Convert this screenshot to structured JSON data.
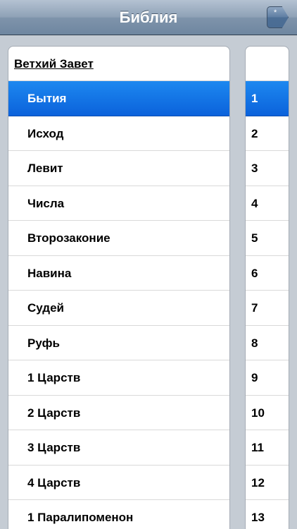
{
  "navbar": {
    "title": "Библия",
    "button_icon": "bookmark-tag-icon",
    "button_glyph": "*"
  },
  "books": {
    "section_title": "Ветхий Завет",
    "selected_index": 0,
    "items": [
      {
        "label": "Бытия"
      },
      {
        "label": "Исход"
      },
      {
        "label": "Левит"
      },
      {
        "label": "Числа"
      },
      {
        "label": "Второзаконие"
      },
      {
        "label": "Навина"
      },
      {
        "label": "Судей"
      },
      {
        "label": "Руфь"
      },
      {
        "label": "1 Царств"
      },
      {
        "label": "2 Царств"
      },
      {
        "label": "3 Царств"
      },
      {
        "label": "4 Царств"
      },
      {
        "label": "1 Паралипоменон"
      }
    ]
  },
  "chapters": {
    "selected_index": 0,
    "items": [
      {
        "label": "1"
      },
      {
        "label": "2"
      },
      {
        "label": "3"
      },
      {
        "label": "4"
      },
      {
        "label": "5"
      },
      {
        "label": "6"
      },
      {
        "label": "7"
      },
      {
        "label": "8"
      },
      {
        "label": "9"
      },
      {
        "label": "10"
      },
      {
        "label": "11"
      },
      {
        "label": "12"
      },
      {
        "label": "13"
      }
    ]
  },
  "colors": {
    "selection": "#0b62db",
    "navbar": "#7f94ab",
    "background": "#c5ccd4"
  }
}
